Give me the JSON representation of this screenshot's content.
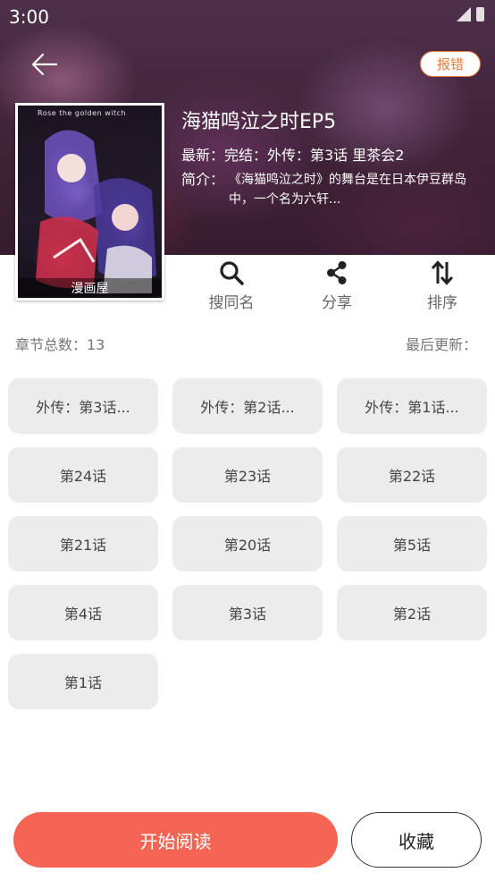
{
  "status_bar": {
    "time": "3:00"
  },
  "header": {
    "report_label": "报错",
    "title": "海猫鸣泣之时EP5",
    "latest": "最新：完结：外传：第3话 里茶会2",
    "intro_label": "简介：",
    "intro_text": "《海猫鸣泣之时》的舞台是在日本伊豆群岛中，一个名为六轩..."
  },
  "cover": {
    "top_text": "Rose the golden witch",
    "label": "漫画屋"
  },
  "actions": [
    {
      "label": "搜同名",
      "icon": "search-icon"
    },
    {
      "label": "分享",
      "icon": "share-icon"
    },
    {
      "label": "排序",
      "icon": "sort-icon"
    }
  ],
  "stats": {
    "total": "章节总数：13",
    "updated": "最后更新："
  },
  "chapters": [
    "外传：第3话...",
    "外传：第2话...",
    "外传：第1话...",
    "第24话",
    "第23话",
    "第22话",
    "第21话",
    "第20话",
    "第5话",
    "第4话",
    "第3话",
    "第2话",
    "第1话"
  ],
  "footer": {
    "start_label": "开始阅读",
    "favorite_label": "收藏"
  },
  "colors": {
    "accent": "#f66554",
    "report": "#f07a3c"
  }
}
